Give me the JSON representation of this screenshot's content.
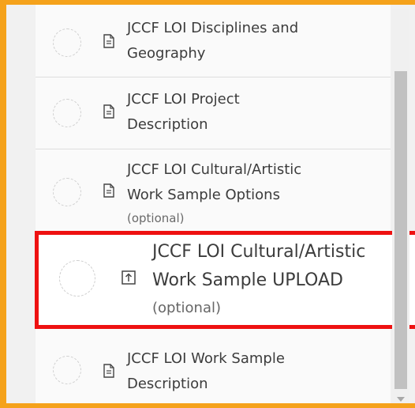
{
  "colors": {
    "outer_highlight": "#f5a21b",
    "selected_highlight": "#ee1111"
  },
  "steps": [
    {
      "icon": "document-icon",
      "label_line1": "JCCF LOI Disciplines and",
      "label_line2": "Geography",
      "optional": ""
    },
    {
      "icon": "document-icon",
      "label_line1": "JCCF LOI Project",
      "label_line2": "Description",
      "optional": ""
    },
    {
      "icon": "document-icon",
      "label_line1": "JCCF LOI Cultural/Artistic",
      "label_line2": "Work Sample Options",
      "optional": "(optional)"
    },
    {
      "icon": "upload-icon",
      "label_line1": "JCCF LOI Cultural/Artistic",
      "label_line2": "Work Sample UPLOAD",
      "optional": "(optional)"
    },
    {
      "icon": "document-icon",
      "label_line1": "JCCF LOI Work Sample",
      "label_line2": "Description",
      "optional": ""
    }
  ]
}
